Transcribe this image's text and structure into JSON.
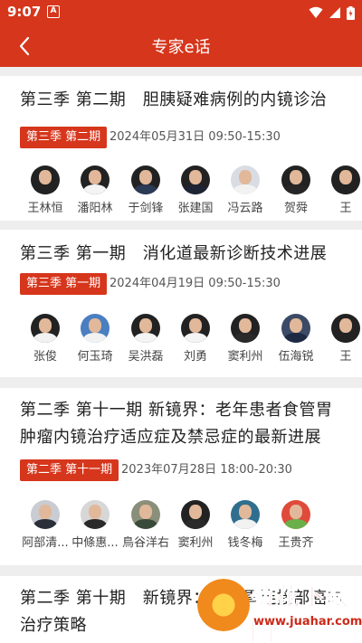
{
  "status_bar": {
    "time": "9:07",
    "notification_icon": "A"
  },
  "header": {
    "title": "专家e话",
    "back_icon": "chevron-left-icon"
  },
  "episodes": [
    {
      "title": "第三季 第二期　胆胰疑难病例的内镜诊治",
      "tag": "第三季 第二期",
      "date": "2024年05月31日  09:50-15:30",
      "experts": [
        "王林恒",
        "潘阳林",
        "于剑锋",
        "张建国",
        "冯云路",
        "贺舜",
        "王"
      ]
    },
    {
      "title": "第三季 第一期　消化道最新诊断技术进展",
      "tag": "第三季 第一期",
      "date": "2024年04月19日  09:50-15:30",
      "experts": [
        "张俊",
        "何玉琦",
        "吴洪磊",
        "刘勇",
        "窦利州",
        "伍海锐",
        "王"
      ]
    },
    {
      "title": "第二季 第十一期 新镜界：老年患者食管胃肿瘤内镜治疗适应症及禁忌症的最新进展",
      "tag": "第二季 第十一期",
      "date": "2023年07月28日  18:00-20:30",
      "experts": [
        "阿部清...",
        "中條惠...",
        "鳥谷洋右",
        "窦利州",
        "钱冬梅",
        "王贵齐"
      ]
    },
    {
      "title": "第二季 第十期　新镜界：食管胃连接部癌的治疗策略"
    }
  ],
  "watermark": {
    "text": "菊花下载网",
    "url": "www.juahar.com"
  },
  "colors": {
    "brand_red": "#d6361c",
    "background": "#eeeeee"
  }
}
